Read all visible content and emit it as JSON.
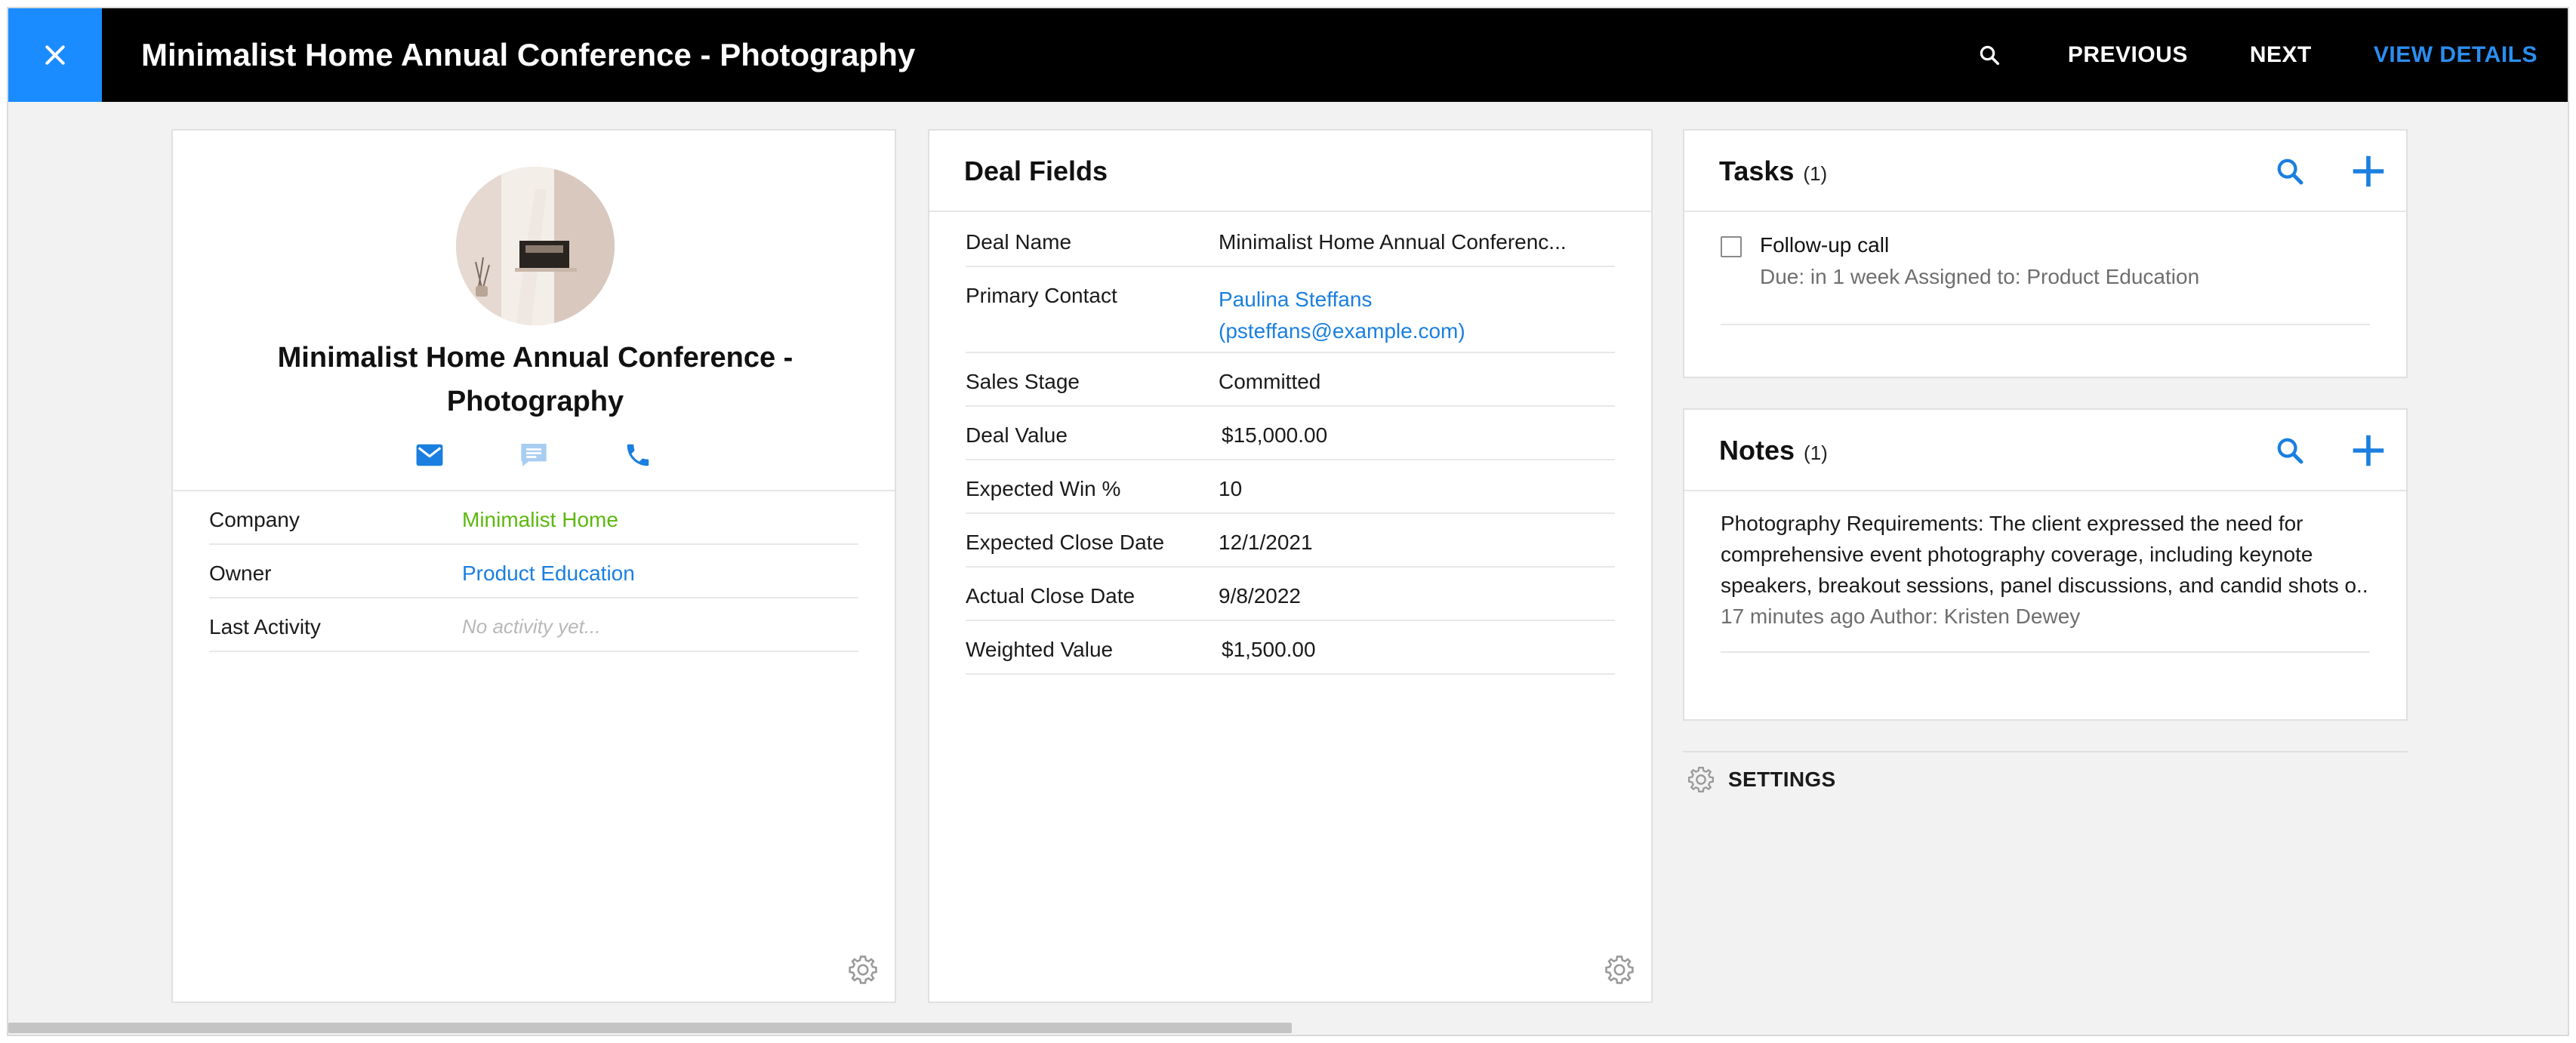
{
  "header": {
    "title": "Minimalist Home Annual Conference - Photography",
    "previous_label": "PREVIOUS",
    "next_label": "NEXT",
    "view_details_label": "VIEW DETAILS",
    "accent_color": "#1a8cff"
  },
  "profile": {
    "name": "Minimalist Home Annual Conference - Photography",
    "actions": [
      "email-icon",
      "message-icon",
      "phone-icon"
    ],
    "fields": [
      {
        "label": "Company",
        "value": "Minimalist Home"
      },
      {
        "label": "Owner",
        "value": "Product Education"
      },
      {
        "label": "Last Activity",
        "value": "No activity yet..."
      }
    ]
  },
  "deal": {
    "title": "Deal Fields",
    "fields": [
      {
        "label": "Deal Name",
        "value": "Minimalist Home Annual Conferenc..."
      },
      {
        "label": "Primary Contact",
        "value": "Paulina Steffans",
        "value2": "(psteffans@example.com)"
      },
      {
        "label": "Sales Stage",
        "value": "Committed"
      },
      {
        "label": "Deal Value",
        "value": "$15,000.00"
      },
      {
        "label": "Expected Win %",
        "value": "10"
      },
      {
        "label": "Expected Close Date",
        "value": "12/1/2021"
      },
      {
        "label": "Actual Close Date",
        "value": "9/8/2022"
      },
      {
        "label": "Weighted Value",
        "value": "$1,500.00"
      }
    ]
  },
  "tasks": {
    "title": "Tasks",
    "count": "(1)",
    "items": [
      {
        "title": "Follow-up call",
        "meta": "Due: in 1 week Assigned to: Product Education"
      }
    ]
  },
  "notes": {
    "title": "Notes",
    "count": "(1)",
    "items": [
      {
        "lines": [
          "Photography Requirements: The client expressed the need for",
          "comprehensive event photography coverage, including keynote",
          "speakers, breakout sessions, panel discussions, and candid shots o..."
        ],
        "meta": "17 minutes ago Author: Kristen Dewey"
      }
    ]
  },
  "settings": {
    "label": "SETTINGS"
  }
}
